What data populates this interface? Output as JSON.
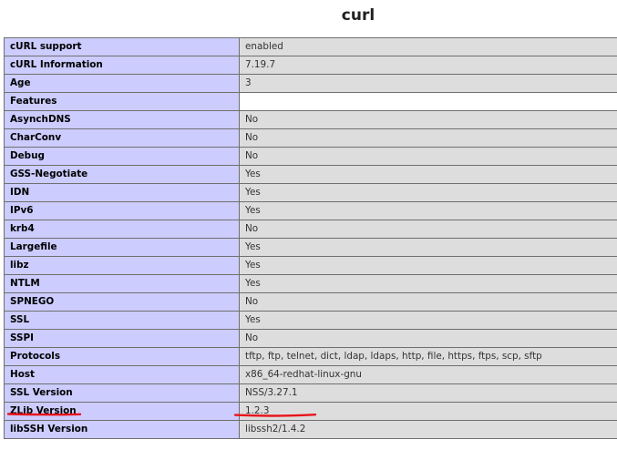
{
  "section": {
    "title": "curl"
  },
  "rows": [
    {
      "key": "cURL support",
      "value": "enabled"
    },
    {
      "key": "cURL Information",
      "value": "7.19.7"
    },
    {
      "key": "Age",
      "value": "3"
    },
    {
      "key": "Features",
      "value": ""
    },
    {
      "key": "AsynchDNS",
      "value": "No"
    },
    {
      "key": "CharConv",
      "value": "No"
    },
    {
      "key": "Debug",
      "value": "No"
    },
    {
      "key": "GSS-Negotiate",
      "value": "Yes"
    },
    {
      "key": "IDN",
      "value": "Yes"
    },
    {
      "key": "IPv6",
      "value": "Yes"
    },
    {
      "key": "krb4",
      "value": "No"
    },
    {
      "key": "Largefile",
      "value": "Yes"
    },
    {
      "key": "libz",
      "value": "Yes"
    },
    {
      "key": "NTLM",
      "value": "Yes"
    },
    {
      "key": "SPNEGO",
      "value": "No"
    },
    {
      "key": "SSL",
      "value": "Yes"
    },
    {
      "key": "SSPI",
      "value": "No"
    },
    {
      "key": "Protocols",
      "value": "tftp, ftp, telnet, dict, ldap, ldaps, http, file, https, ftps, scp, sftp"
    },
    {
      "key": "Host",
      "value": "x86_64-redhat-linux-gnu"
    },
    {
      "key": "SSL Version",
      "value": "NSS/3.27.1"
    },
    {
      "key": "ZLib Version",
      "value": "1.2.3"
    },
    {
      "key": "libSSH Version",
      "value": "libssh2/1.4.2"
    }
  ],
  "colors": {
    "key_background": "#ccccff",
    "value_background": "#dddddd",
    "border": "#6f6f6f",
    "annotation_underline": "#e8141b"
  }
}
